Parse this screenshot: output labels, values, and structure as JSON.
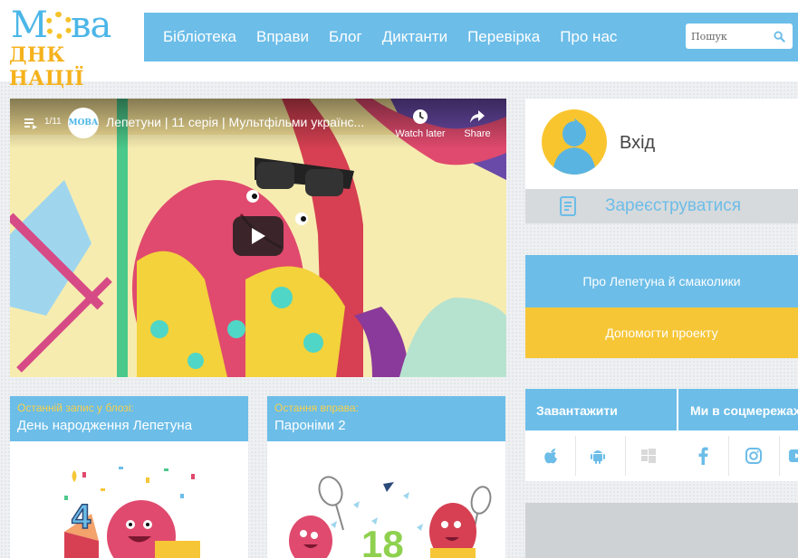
{
  "logo": {
    "top_prefix": "М",
    "top_suffix": "ва",
    "bottom": "ДНК НАЦІЇ"
  },
  "nav": {
    "items": [
      "Бібліотека",
      "Вправи",
      "Блог",
      "Диктанти",
      "Перевірка",
      "Про нас"
    ],
    "search_placeholder": "Пошук"
  },
  "video": {
    "playlist_count": "1/11",
    "channel_avatar_text": "МОВА",
    "title": "Лепетуни | 11 серія | Мультфільми українс...",
    "watch_later": "Watch later",
    "share": "Share"
  },
  "account": {
    "login": "Вхід",
    "register": "Зареєструватися"
  },
  "buttons": {
    "about": "Про Лепетуна й смаколики",
    "help": "Допомогти проекту"
  },
  "downloads": {
    "title": "Завантажити",
    "social_title": "Ми в соцмережах"
  },
  "cards": [
    {
      "kicker": "Останній запис у блозі:",
      "title": "День народження Лепетуна"
    },
    {
      "kicker": "Остання вправа:",
      "title": "Пароніми 2"
    }
  ],
  "card_art": {
    "cake_number": "4",
    "exercise_number": "18"
  },
  "colors": {
    "brand_blue": "#6cbde8",
    "brand_yellow": "#f6c637",
    "pink": "#e04a6e"
  }
}
